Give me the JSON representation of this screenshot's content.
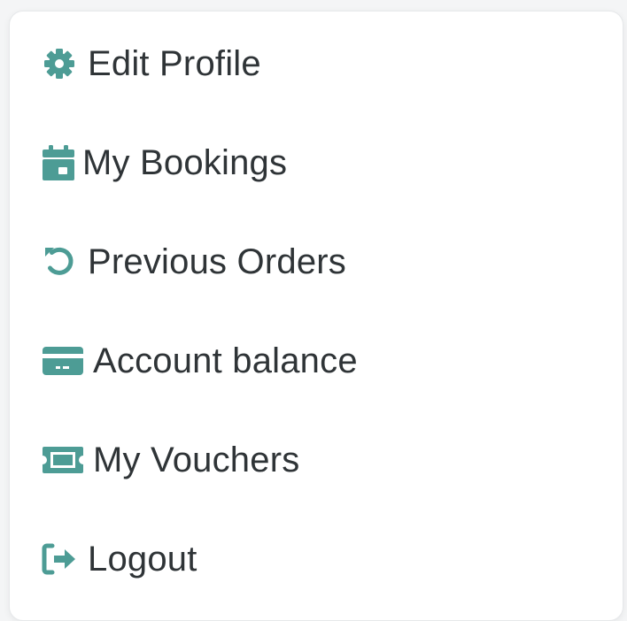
{
  "accent_color": "#4d9c95",
  "menu": {
    "items": [
      {
        "label": "Edit Profile",
        "icon": "gear-icon"
      },
      {
        "label": "My Bookings",
        "icon": "calendar-icon"
      },
      {
        "label": "Previous Orders",
        "icon": "history-icon"
      },
      {
        "label": "Account balance",
        "icon": "credit-card-icon"
      },
      {
        "label": "My Vouchers",
        "icon": "ticket-icon"
      },
      {
        "label": "Logout",
        "icon": "logout-icon"
      }
    ]
  }
}
